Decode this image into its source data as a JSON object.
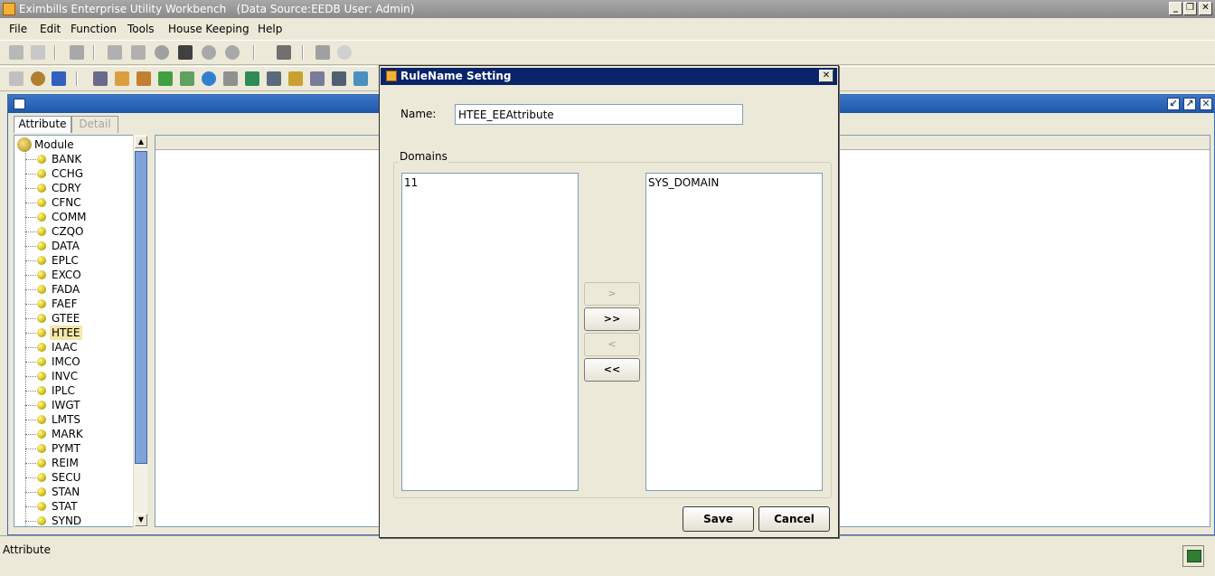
{
  "window": {
    "title": "Eximbills Enterprise Utility Workbench   (Data Source:EEDB User: Admin)",
    "controls": {
      "minimize": "_",
      "restore": "❐",
      "close": "✕"
    }
  },
  "menu": [
    "File",
    "Edit",
    "Function",
    "Tools",
    "House Keeping",
    "Help"
  ],
  "inner_window": {
    "tabs": [
      {
        "label": "Attribute",
        "active": true
      },
      {
        "label": "Detail",
        "active": false
      }
    ]
  },
  "tree": {
    "root": "Module",
    "selected": "HTEE",
    "items": [
      "BANK",
      "CCHG",
      "CDRY",
      "CFNC",
      "COMM",
      "CZQO",
      "DATA",
      "EPLC",
      "EXCO",
      "FADA",
      "FAEF",
      "GTEE",
      "HTEE",
      "IAAC",
      "IMCO",
      "INVC",
      "IPLC",
      "IWGT",
      "LMTS",
      "MARK",
      "PYMT",
      "REIM",
      "SECU",
      "STAN",
      "STAT",
      "SYND"
    ]
  },
  "dialog": {
    "title": "RuleName Setting",
    "name_label": "Name:",
    "name_value": "HTEE_EEAttribute",
    "domains_caption": "Domains",
    "left_list": [
      "11"
    ],
    "right_list": [
      "SYS_DOMAIN"
    ],
    "move_buttons": [
      ">",
      ">>",
      "<",
      "<<"
    ],
    "save_label": "Save",
    "cancel_label": "Cancel"
  },
  "status": {
    "text": "Attribute"
  },
  "colors": {
    "titlebar_inactive": "#8a8a8a",
    "dialog_title": "#0a246a",
    "inner_title": "#2057a8",
    "selection": "#f7e6a8"
  }
}
